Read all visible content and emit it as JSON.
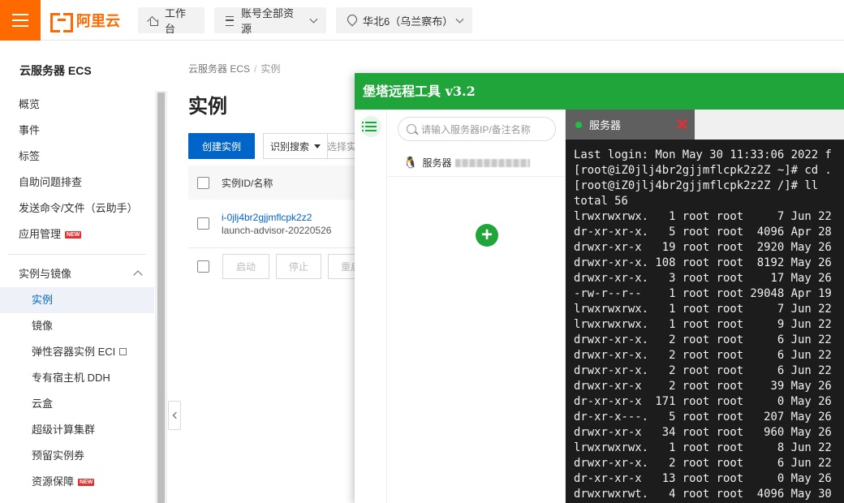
{
  "topbar": {
    "logo_text": "阿里云",
    "workbench": "工作台",
    "resource_scope": "账号全部资源",
    "region": "华北6（乌兰察布）"
  },
  "sidebar": {
    "title": "云服务器 ECS",
    "items": [
      {
        "label": "概览"
      },
      {
        "label": "事件"
      },
      {
        "label": "标签"
      },
      {
        "label": "自助问题排查"
      },
      {
        "label": "发送命令/文件（云助手）"
      },
      {
        "label": "应用管理",
        "badge": "NEW"
      }
    ],
    "group": {
      "label": "实例与镜像",
      "items": [
        {
          "label": "实例",
          "active": true
        },
        {
          "label": "镜像"
        },
        {
          "label": "弹性容器实例 ECI"
        },
        {
          "label": "专有宿主机 DDH"
        },
        {
          "label": "云盒"
        },
        {
          "label": "超级计算集群"
        },
        {
          "label": "预留实例券"
        },
        {
          "label": "资源保障",
          "badge": "NEW"
        }
      ]
    }
  },
  "main": {
    "breadcrumb": [
      "云服务器 ECS",
      "实例"
    ],
    "title": "实例",
    "create_button": "创建实例",
    "search_type": "识别搜索",
    "search_placeholder": "选择实",
    "table": {
      "header": "实例ID/名称",
      "rows": [
        {
          "id": "i-0jlj4br2gjjmflcpk2z2",
          "name": "launch-advisor-20220526"
        }
      ]
    },
    "batch_buttons": [
      "启动",
      "停止",
      "重启"
    ]
  },
  "tool": {
    "title": "堡塔远程工具 v3.2",
    "search_placeholder": "请输入服务器IP/备注名称",
    "server_label": "服务器",
    "tab_label": "服务器",
    "terminal_lines": [
      "Last login: Mon May 30 11:33:06 2022 f",
      "[root@iZ0jlj4br2gjjmflcpk2z2Z ~]# cd .",
      "[root@iZ0jlj4br2gjjmflcpk2z2Z /]# ll",
      "total 56",
      "lrwxrwxrwx.   1 root root     7 Jun 22",
      "dr-xr-xr-x.   5 root root  4096 Apr 28",
      "drwxr-xr-x   19 root root  2920 May 26",
      "drwxr-xr-x. 108 root root  8192 May 26",
      "drwxr-xr-x.   3 root root    17 May 26",
      "-rw-r--r--    1 root root 29048 Apr 19",
      "lrwxrwxrwx.   1 root root     7 Jun 22",
      "lrwxrwxrwx.   1 root root     9 Jun 22",
      "drwxr-xr-x.   2 root root     6 Jun 22",
      "drwxr-xr-x.   2 root root     6 Jun 22",
      "drwxr-xr-x.   2 root root     6 Jun 22",
      "drwxr-xr-x    2 root root    39 May 26",
      "dr-xr-xr-x  171 root root     0 May 26",
      "dr-xr-x---.   5 root root   207 May 26",
      "drwxr-xr-x   34 root root   960 May 26",
      "lrwxrwxrwx.   1 root root     8 Jun 22",
      "drwxr-xr-x.   2 root root     6 Jun 22",
      "dr-xr-xr-x   13 root root     0 May 26",
      "drwxrwxrwt.   4 root root  4096 May 30"
    ]
  },
  "colors": {
    "brand_orange": "#ff6a00",
    "primary_blue": "#0064c8",
    "tool_green": "#20a53a",
    "terminal_bg": "#1c1c1c"
  }
}
